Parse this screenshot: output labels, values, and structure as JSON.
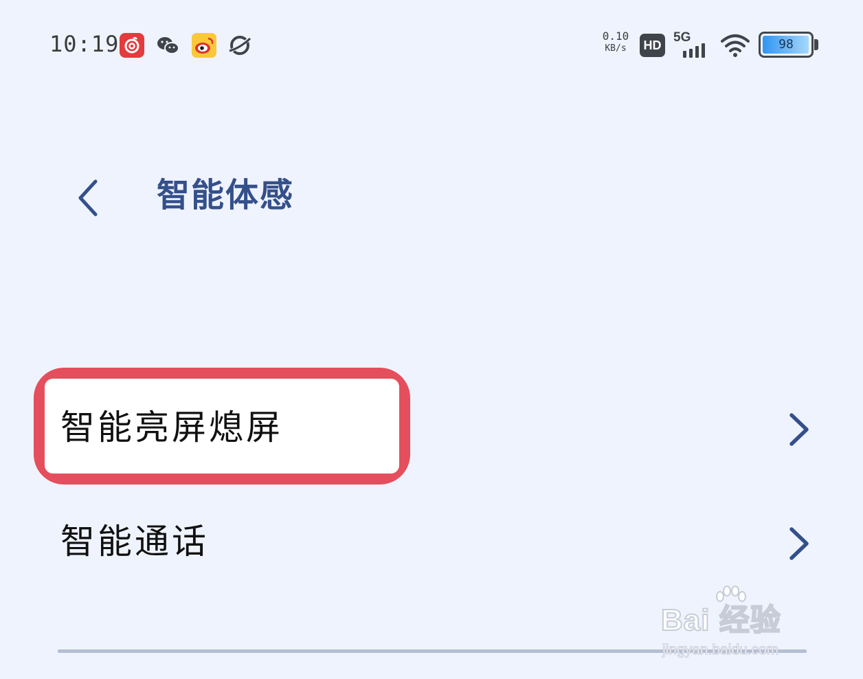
{
  "status_bar": {
    "time": "10:19",
    "app_icons": [
      "netease-music-icon",
      "wechat-icon",
      "weibo-icon",
      "planet-icon"
    ],
    "net_speed_value": "0.10",
    "net_speed_unit": "KB/s",
    "hd_label": "HD",
    "network_label": "5G",
    "battery_level": "98",
    "battery_fraction": 0.98
  },
  "header": {
    "back_icon": "chevron-left-icon",
    "title": "智能体感"
  },
  "settings": {
    "items": [
      {
        "label": "智能亮屏熄屏",
        "icon": "chevron-right-icon",
        "highlighted": true
      },
      {
        "label": "智能通话",
        "icon": "chevron-right-icon",
        "highlighted": false
      }
    ]
  },
  "watermark": {
    "logo": "Bai 经验",
    "url": "jingyan.baidu.com"
  },
  "colors": {
    "background": "#eff3fd",
    "accent": "#34508a",
    "highlight": "#e54e5c"
  }
}
